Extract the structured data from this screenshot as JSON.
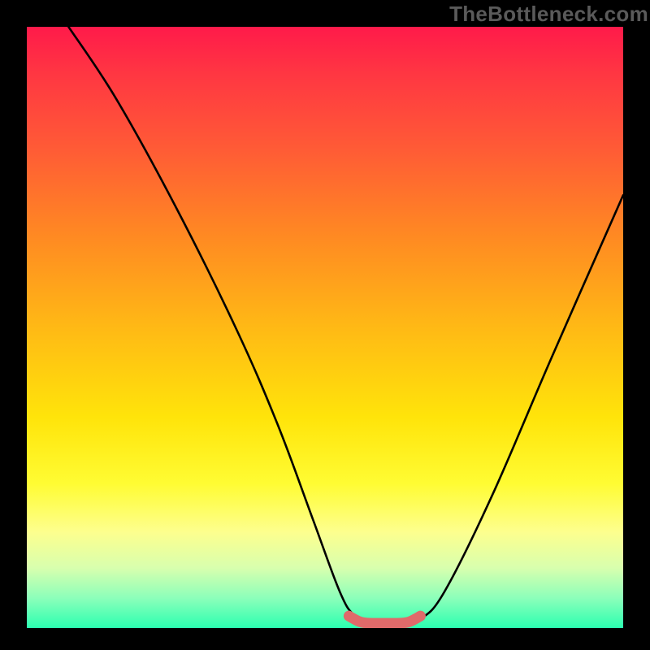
{
  "watermark": "TheBottleneck.com",
  "chart_data": {
    "type": "line",
    "title": "",
    "xlabel": "",
    "ylabel": "",
    "xlim": [
      0,
      100
    ],
    "ylim": [
      0,
      100
    ],
    "series": [
      {
        "name": "black-curve",
        "color": "#000000",
        "x": [
          7,
          15,
          25,
          35,
          42,
          48,
          52.5,
          55,
          58,
          60,
          63,
          66,
          70,
          78,
          88,
          100
        ],
        "y": [
          100,
          88,
          70,
          50,
          34,
          18,
          6,
          2,
          0.5,
          0.5,
          0.5,
          1.5,
          6,
          22,
          45,
          72
        ]
      },
      {
        "name": "red-marker-band",
        "color": "#e06a6a",
        "x": [
          54,
          56,
          58,
          60,
          62,
          64,
          66
        ],
        "y": [
          2,
          1,
          0.8,
          0.8,
          0.8,
          1,
          2
        ]
      }
    ],
    "background_gradient": {
      "top": "#ff1a4a",
      "upper_mid": "#ff8a22",
      "mid": "#ffe40a",
      "lower_mid": "#fdff8e",
      "bottom": "#2bffb0"
    }
  }
}
